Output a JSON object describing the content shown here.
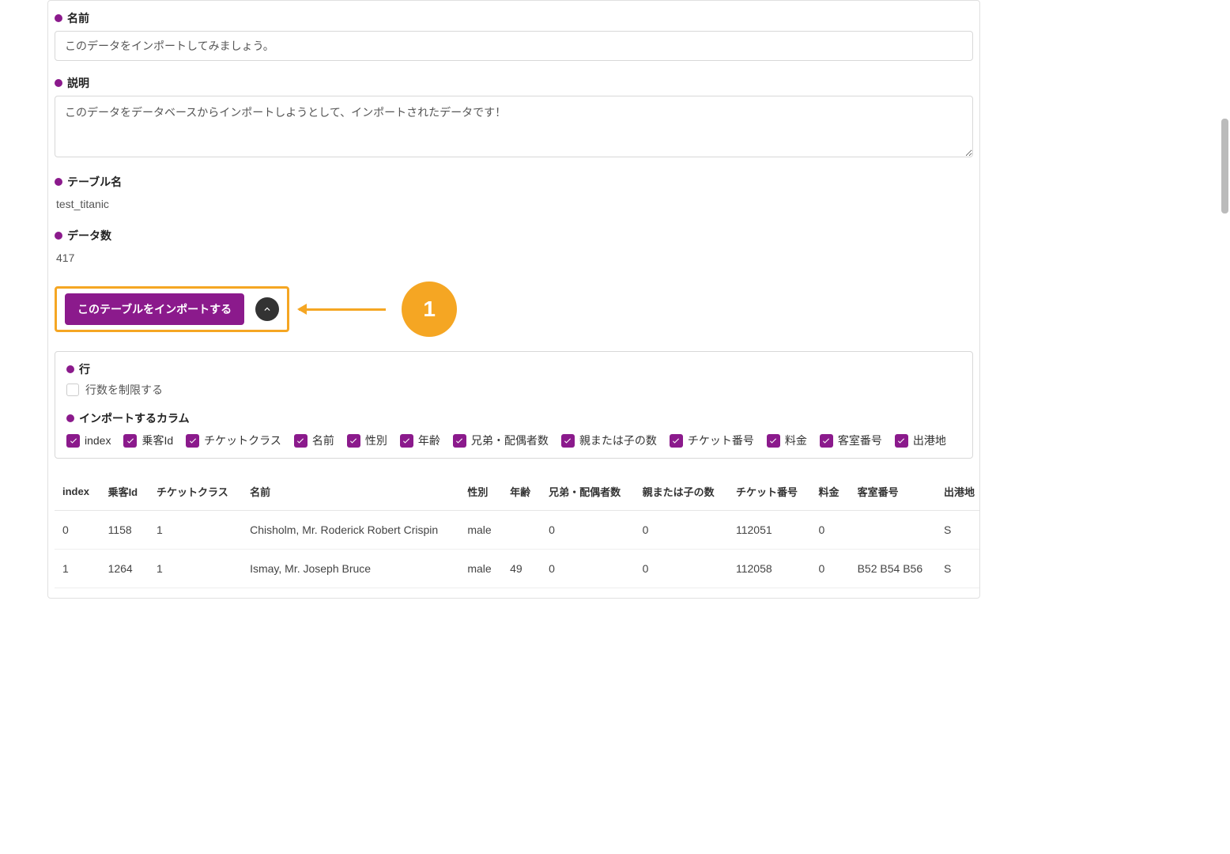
{
  "form": {
    "name_label": "名前",
    "name_value": "このデータをインポートしてみましょう。",
    "desc_label": "説明",
    "desc_value": "このデータをデータベースからインポートしようとして、インポートされたデータです！",
    "table_label": "テーブル名",
    "table_value": "test_titanic",
    "count_label": "データ数",
    "count_value": "417",
    "import_button": "このテーブルをインポートする"
  },
  "callout": {
    "num": "1"
  },
  "options": {
    "rows_label": "行",
    "limit_rows_label": "行数を制限する",
    "columns_label": "インポートするカラム",
    "columns": [
      "index",
      "乗客Id",
      "チケットクラス",
      "名前",
      "性別",
      "年齢",
      "兄弟・配偶者数",
      "親または子の数",
      "チケット番号",
      "料金",
      "客室番号",
      "出港地"
    ]
  },
  "table": {
    "headers": [
      "index",
      "乗客Id",
      "チケットクラス",
      "名前",
      "性別",
      "年齢",
      "兄弟・配偶者数",
      "親または子の数",
      "チケット番号",
      "料金",
      "客室番号",
      "出港地"
    ],
    "rows": [
      [
        "0",
        "1158",
        "1",
        "Chisholm, Mr. Roderick Robert Crispin",
        "male",
        "",
        "0",
        "0",
        "112051",
        "0",
        "",
        "S"
      ],
      [
        "1",
        "1264",
        "1",
        "Ismay, Mr. Joseph Bruce",
        "male",
        "49",
        "0",
        "0",
        "112058",
        "0",
        "B52 B54 B56",
        "S"
      ]
    ]
  }
}
